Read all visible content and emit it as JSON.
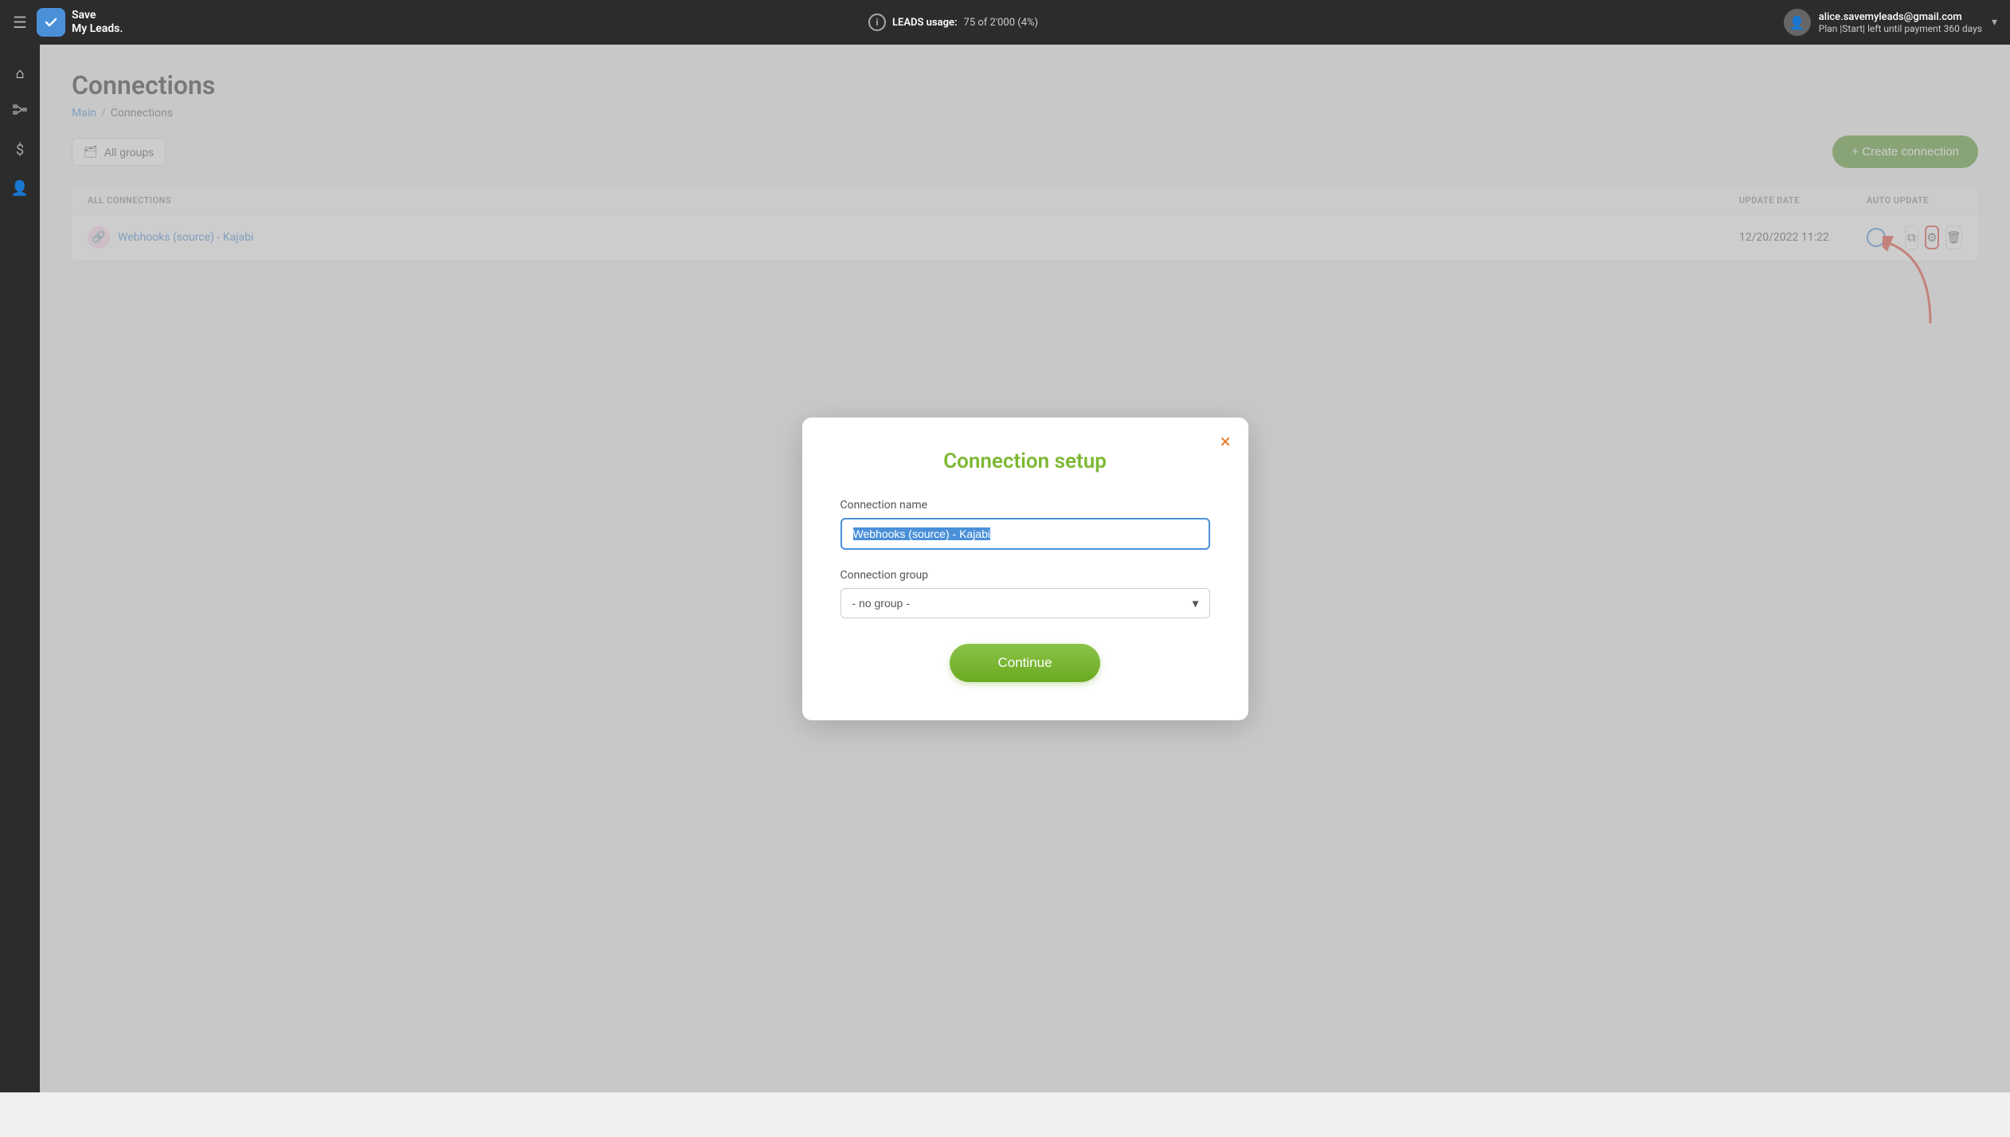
{
  "navbar": {
    "hamburger_icon": "☰",
    "logo_line1": "Save",
    "logo_line2": "My Leads.",
    "leads_usage_label": "LEADS usage:",
    "leads_usage_value": "75 of 2'000 (4%)",
    "user_email": "alice.savemyleads@gmail.com",
    "user_plan": "Plan |Start| left until payment 360 days",
    "chevron": "▾"
  },
  "sidebar": {
    "items": [
      {
        "icon": "⌂",
        "label": "home"
      },
      {
        "icon": "⛶",
        "label": "connections"
      },
      {
        "icon": "$",
        "label": "billing"
      },
      {
        "icon": "👤",
        "label": "account"
      }
    ]
  },
  "page": {
    "title": "Connections",
    "breadcrumb_main": "Main",
    "breadcrumb_sep": "/",
    "breadcrumb_current": "Connections"
  },
  "toolbar": {
    "all_groups_label": "All groups",
    "create_connection_label": "+ Create connection"
  },
  "table": {
    "headers": [
      "ALL CONNECTIONS",
      "",
      "UPDATE DATE",
      "AUTO UPDATE"
    ],
    "rows": [
      {
        "name": "Webhooks (source) - Kajabi",
        "update_date": "12/20/2022 11:22",
        "auto_update": true
      }
    ]
  },
  "modal": {
    "close_icon": "×",
    "title": "Connection setup",
    "connection_name_label": "Connection name",
    "connection_name_value": "Webhooks (source) - Kajabi",
    "connection_group_label": "Connection group",
    "connection_group_value": "- no group -",
    "group_options": [
      "- no group -"
    ],
    "continue_label": "Continue"
  },
  "colors": {
    "accent_blue": "#4a90d9",
    "green": "#7cb832",
    "orange": "#e88030",
    "red": "#e74c3c",
    "dark_bg": "#2c2c2c"
  }
}
